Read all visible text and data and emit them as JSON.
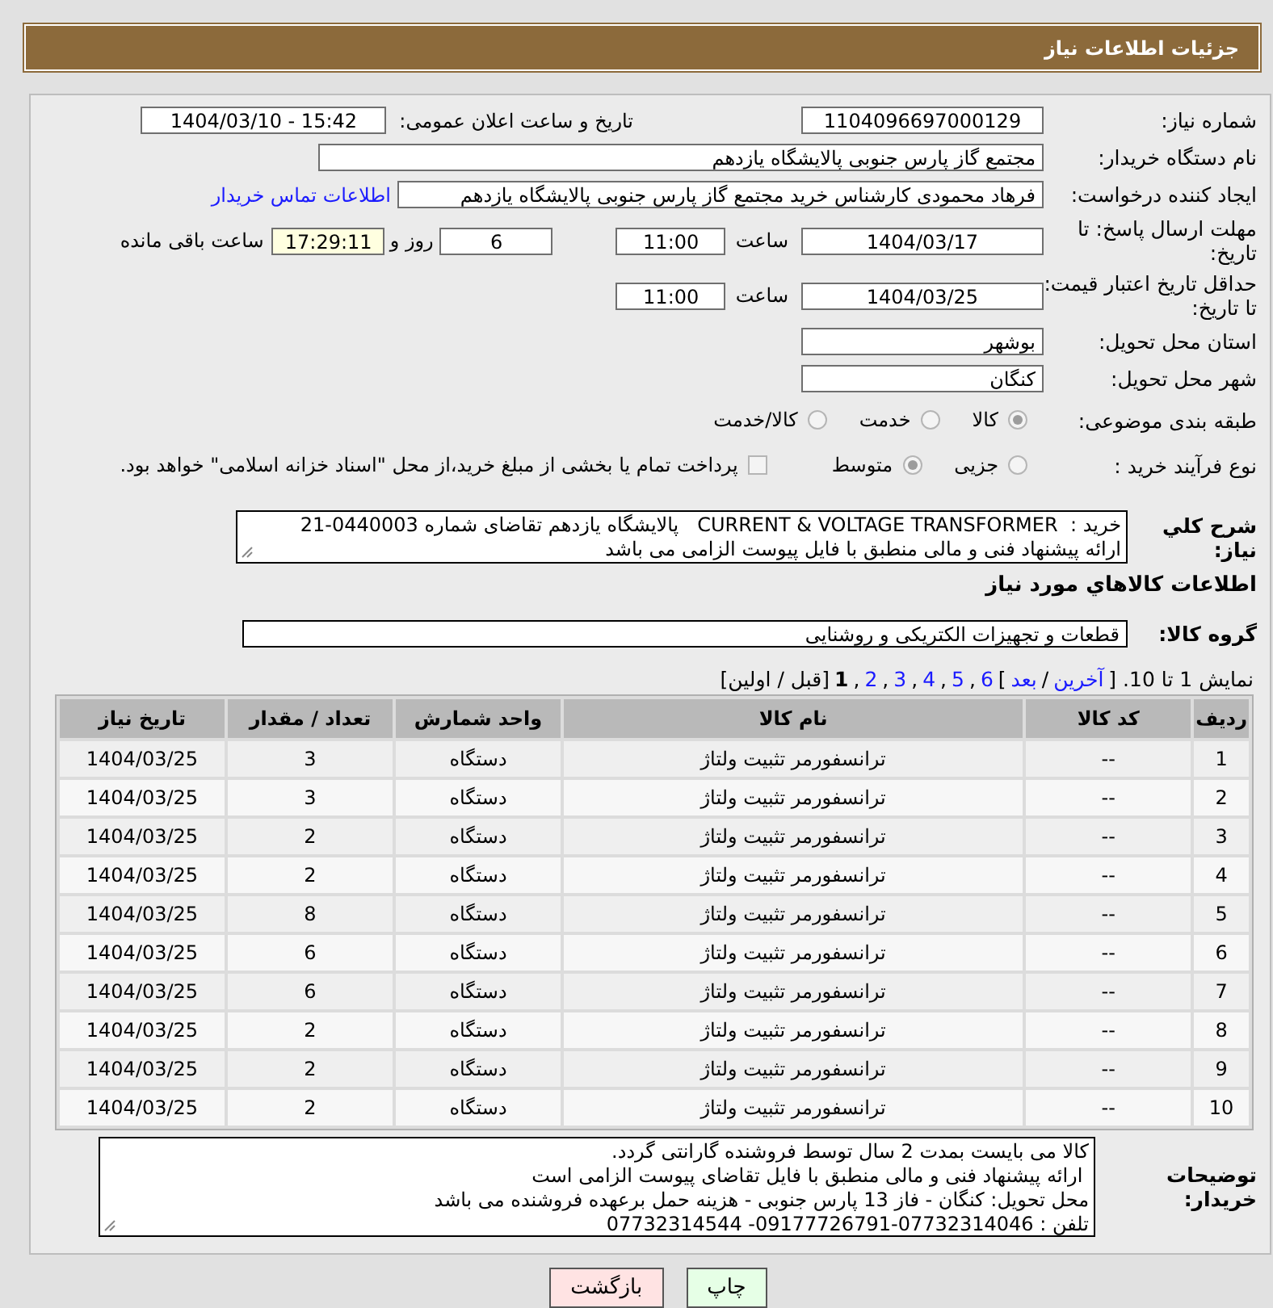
{
  "header": {
    "title": "جزئیات اطلاعات نیاز"
  },
  "need_number": {
    "label": "شماره نیاز:",
    "value": "1104096697000129"
  },
  "announce": {
    "label": "تاریخ و ساعت اعلان عمومی:",
    "value": "1404/03/10 - 15:42"
  },
  "buyer_org": {
    "label": "نام دستگاه خریدار:",
    "value": "مجتمع گاز پارس جنوبی  پالایشگاه یازدهم"
  },
  "requester": {
    "label": "ایجاد کننده درخواست:",
    "value": "فرهاد محمودی کارشناس خرید مجتمع گاز پارس جنوبی  پالایشگاه یازدهم",
    "link": "اطلاعات تماس خریدار"
  },
  "reply_deadline": {
    "label": "مهلت ارسال پاسخ: تا تاریخ:",
    "date": "1404/03/17",
    "time_label": "ساعت",
    "time": "11:00",
    "days": "6",
    "days_label": "روز و",
    "remaining": "17:29:11",
    "remaining_label": "ساعت باقی مانده"
  },
  "price_validity": {
    "label": "حداقل تاریخ اعتبار قیمت: تا تاریخ:",
    "date": "1404/03/25",
    "time_label": "ساعت",
    "time": "11:00"
  },
  "province": {
    "label": "استان محل تحویل:",
    "value": "بوشهر"
  },
  "city": {
    "label": "شهر محل تحویل:",
    "value": "کنگان"
  },
  "category": {
    "label": "طبقه بندی موضوعی:",
    "options": [
      {
        "label": "کالا",
        "selected": true
      },
      {
        "label": "خدمت",
        "selected": false
      },
      {
        "label": "کالا/خدمت",
        "selected": false
      }
    ]
  },
  "process": {
    "label": "نوع فرآیند خرید :",
    "options": [
      {
        "label": "جزیی",
        "selected": false
      },
      {
        "label": "متوسط",
        "selected": true
      }
    ],
    "treasury": {
      "checked": false,
      "label": "پرداخت تمام یا بخشی از مبلغ خرید،از محل \"اسناد خزانه اسلامی\" خواهد بود."
    }
  },
  "description": {
    "label": "شرح کلي نياز:",
    "lines": [
      "خرید :  CURRENT & VOLTAGE TRANSFORMER   پالایشگاه یازدهم تقاضای شماره 0440003-21",
      "ارائه پیشنهاد فنی و مالی منطبق با فایل پیوست الزامی می باشد"
    ]
  },
  "goods_heading": "اطلاعات کالاهاي مورد نياز",
  "goods_group": {
    "label": "گروه کالا:",
    "value": "قطعات و تجهیزات الکتریکی و روشنایی"
  },
  "pagination": [
    {
      "kind": "text",
      "text": "نمایش 1 تا 10. ["
    },
    {
      "kind": "link",
      "text": "آخرین"
    },
    {
      "kind": "text",
      "text": "/"
    },
    {
      "kind": "link",
      "text": "بعد"
    },
    {
      "kind": "text",
      "text": "]"
    },
    {
      "kind": "link",
      "text": "6"
    },
    {
      "kind": "text",
      "text": ","
    },
    {
      "kind": "link",
      "text": "5"
    },
    {
      "kind": "text",
      "text": ","
    },
    {
      "kind": "link",
      "text": "4"
    },
    {
      "kind": "text",
      "text": ","
    },
    {
      "kind": "link",
      "text": "3"
    },
    {
      "kind": "text",
      "text": ","
    },
    {
      "kind": "link",
      "text": "2"
    },
    {
      "kind": "text",
      "text": ","
    },
    {
      "kind": "current",
      "text": "1"
    },
    {
      "kind": "text",
      "text": "[قبل / اولین]"
    }
  ],
  "table": {
    "columns": [
      "ردیف",
      "کد کالا",
      "نام کالا",
      "واحد شمارش",
      "تعداد / مقدار",
      "تاریخ نیاز"
    ],
    "rows": [
      [
        "1",
        "--",
        "ترانسفورمر تثبیت ولتاژ",
        "دستگاه",
        "3",
        "1404/03/25"
      ],
      [
        "2",
        "--",
        "ترانسفورمر تثبیت ولتاژ",
        "دستگاه",
        "3",
        "1404/03/25"
      ],
      [
        "3",
        "--",
        "ترانسفورمر تثبیت ولتاژ",
        "دستگاه",
        "2",
        "1404/03/25"
      ],
      [
        "4",
        "--",
        "ترانسفورمر تثبیت ولتاژ",
        "دستگاه",
        "2",
        "1404/03/25"
      ],
      [
        "5",
        "--",
        "ترانسفورمر تثبیت ولتاژ",
        "دستگاه",
        "8",
        "1404/03/25"
      ],
      [
        "6",
        "--",
        "ترانسفورمر تثبیت ولتاژ",
        "دستگاه",
        "6",
        "1404/03/25"
      ],
      [
        "7",
        "--",
        "ترانسفورمر تثبیت ولتاژ",
        "دستگاه",
        "6",
        "1404/03/25"
      ],
      [
        "8",
        "--",
        "ترانسفورمر تثبیت ولتاژ",
        "دستگاه",
        "2",
        "1404/03/25"
      ],
      [
        "9",
        "--",
        "ترانسفورمر تثبیت ولتاژ",
        "دستگاه",
        "2",
        "1404/03/25"
      ],
      [
        "10",
        "--",
        "ترانسفورمر تثبیت ولتاژ",
        "دستگاه",
        "2",
        "1404/03/25"
      ]
    ]
  },
  "buyer_notes": {
    "label": "توضیحات خریدار:",
    "lines": [
      "کالا می بایست بمدت 2 سال توسط فروشنده گارانتی گردد.",
      " ارائه پیشنهاد فنی و مالی منطبق با فایل تقاضای پیوست الزامی است",
      "محل تحویل: کنگان - فاز 13 پارس جنوبی - هزینه حمل برعهده فروشنده می باشد",
      "تلفن : 07732314046-09177726791- 07732314544"
    ]
  },
  "buttons": [
    {
      "label": "چاپ",
      "kind": "print"
    },
    {
      "label": "بازگشت",
      "kind": "back"
    }
  ]
}
